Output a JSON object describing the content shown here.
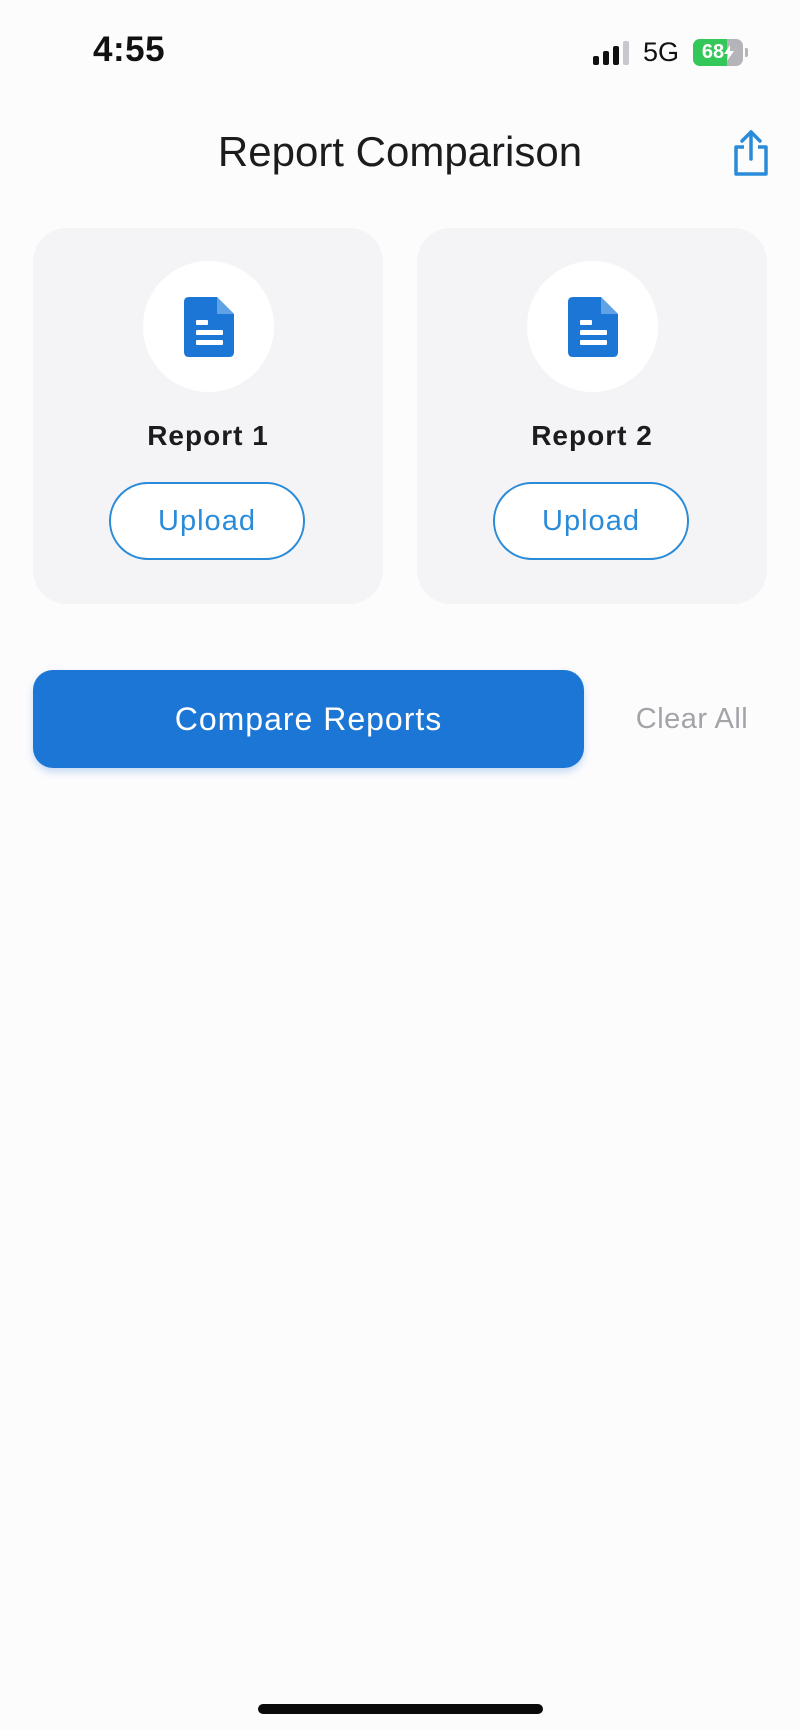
{
  "status_bar": {
    "time": "4:55",
    "network": "5G",
    "battery_level": "68",
    "battery_fraction": 0.68,
    "signal_bars_active": 3,
    "signal_bars_total": 4
  },
  "header": {
    "title": "Report Comparison",
    "share_icon": "share-icon"
  },
  "reports": [
    {
      "title": "Report 1",
      "icon": "document-icon",
      "upload_label": "Upload"
    },
    {
      "title": "Report 2",
      "icon": "document-icon",
      "upload_label": "Upload"
    }
  ],
  "actions": {
    "compare_label": "Compare Reports",
    "clear_label": "Clear All"
  },
  "colors": {
    "accent": "#1C76D5",
    "outline": "#2A8BD8",
    "card_bg": "#F4F4F6",
    "muted": "#A3A3A8",
    "battery_green": "#34C759"
  }
}
